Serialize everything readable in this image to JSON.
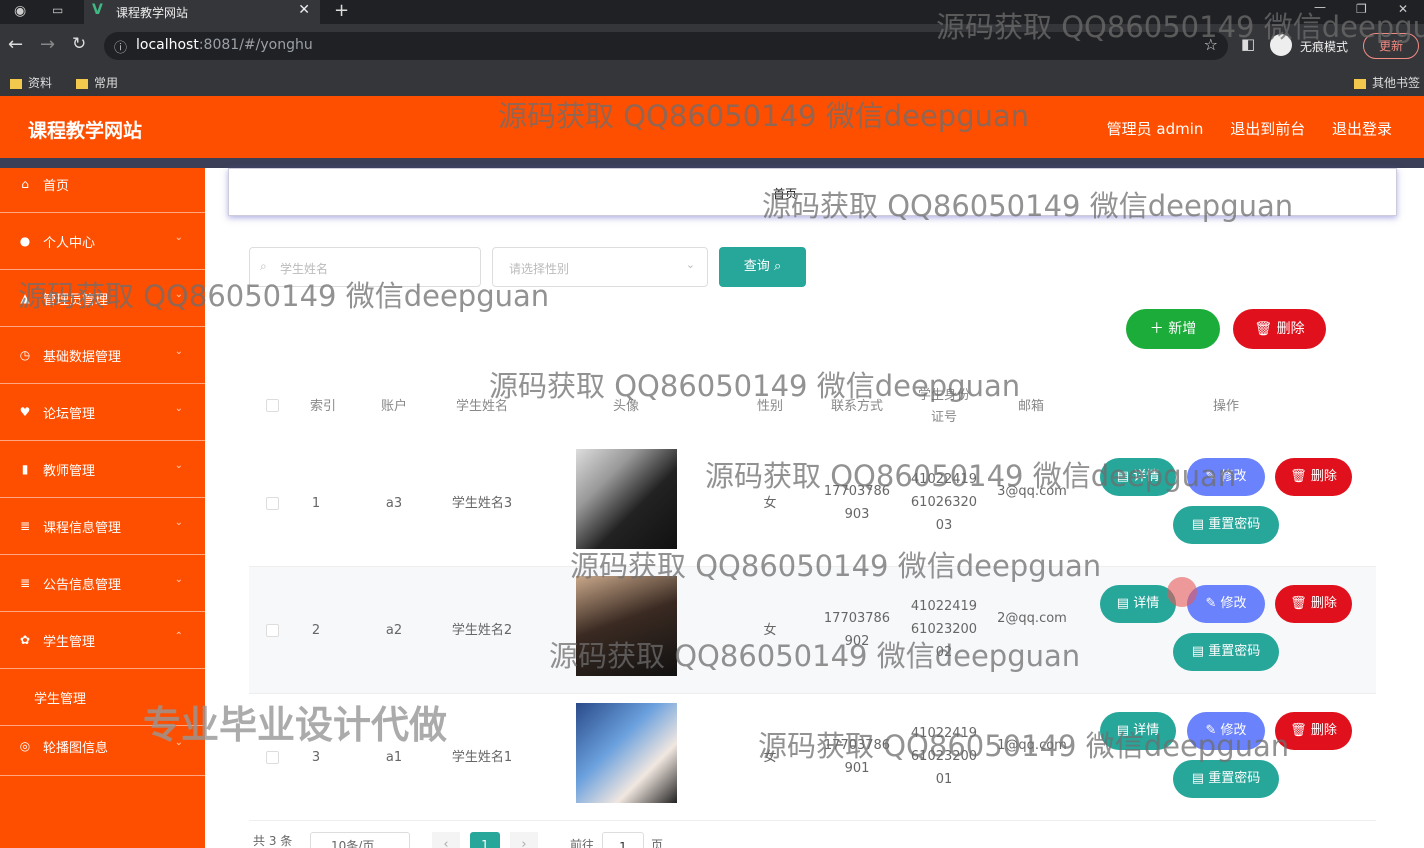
{
  "browser": {
    "tab_title": "课程教学网站",
    "url_host": "localhost",
    "url_rest": ":8081/#/yonghu",
    "profile_label": "无痕模式",
    "update_label": "更新",
    "bookmarks": [
      "资料",
      "常用"
    ],
    "other_bookmarks": "其他书签"
  },
  "header": {
    "site_title": "课程教学网站",
    "admin_label": "管理员 admin",
    "front_label": "退出到前台",
    "logout_label": "退出登录"
  },
  "sidebar": {
    "items": [
      {
        "label": "首页",
        "icon": "home-icon"
      },
      {
        "label": "个人中心",
        "icon": "user-icon"
      },
      {
        "label": "管理员管理",
        "icon": "admin-icon"
      },
      {
        "label": "基础数据管理",
        "icon": "clock-icon"
      },
      {
        "label": "论坛管理",
        "icon": "forum-icon"
      },
      {
        "label": "教师管理",
        "icon": "chart-icon"
      },
      {
        "label": "课程信息管理",
        "icon": "list-icon"
      },
      {
        "label": "公告信息管理",
        "icon": "list-icon"
      },
      {
        "label": "学生管理",
        "icon": "gear-icon"
      },
      {
        "label": "学生管理",
        "icon": ""
      },
      {
        "label": "轮播图信息",
        "icon": "image-icon"
      }
    ]
  },
  "breadcrumb": {
    "home": "首页"
  },
  "search": {
    "name_placeholder": "学生姓名",
    "gender_placeholder": "请选择性别",
    "query_label": "查询"
  },
  "actions": {
    "add_label": "新增",
    "delete_label": "删除"
  },
  "table": {
    "columns": [
      "索引",
      "账户",
      "学生姓名",
      "头像",
      "性别",
      "联系方式",
      "学生身份证号",
      "邮箱",
      "操作"
    ],
    "rows": [
      {
        "index": "1",
        "account": "a3",
        "name": "学生姓名3",
        "gender": "女",
        "phone": "17703786903",
        "idcard": "410224196102632003",
        "email": "3@qq.com"
      },
      {
        "index": "2",
        "account": "a2",
        "name": "学生姓名2",
        "gender": "女",
        "phone": "17703786902",
        "idcard": "410224196102320002",
        "email": "2@qq.com"
      },
      {
        "index": "3",
        "account": "a1",
        "name": "学生姓名1",
        "gender": "女",
        "phone": "17703786901",
        "idcard": "410224196102320001",
        "email": "1@qq.com"
      }
    ],
    "row_buttons": {
      "detail": "详情",
      "edit": "修改",
      "delete": "删除",
      "reset": "重置密码"
    }
  },
  "pager": {
    "total": "共 3 条",
    "page_size": "10条/页",
    "current": "1",
    "goto": "前往",
    "goto_value": "1",
    "unit": "页"
  },
  "watermarks": {
    "text": "源码获取 QQ86050149 微信deepguan",
    "big": "专业毕业设计代做"
  }
}
